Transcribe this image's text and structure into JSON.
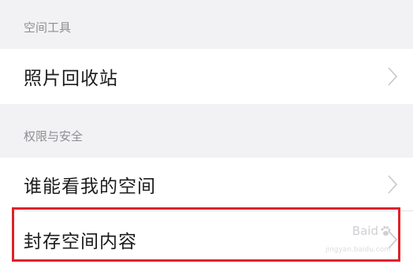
{
  "sections": [
    {
      "header": "空间工具",
      "items": [
        {
          "label": "照片回收站"
        }
      ]
    },
    {
      "header": "权限与安全",
      "items": [
        {
          "label": "谁能看我的空间"
        },
        {
          "label": "封存空间内容"
        }
      ]
    }
  ],
  "watermark": {
    "brand": "Baid",
    "sub": "jingyan.baidu.com"
  },
  "colors": {
    "background": "#f2f2f4",
    "row": "#ffffff",
    "header_text": "#8e8e93",
    "highlight": "#e0212b"
  },
  "icons": {
    "chevron": "chevron-right-icon",
    "watermark": "baidu-paw-icon"
  }
}
